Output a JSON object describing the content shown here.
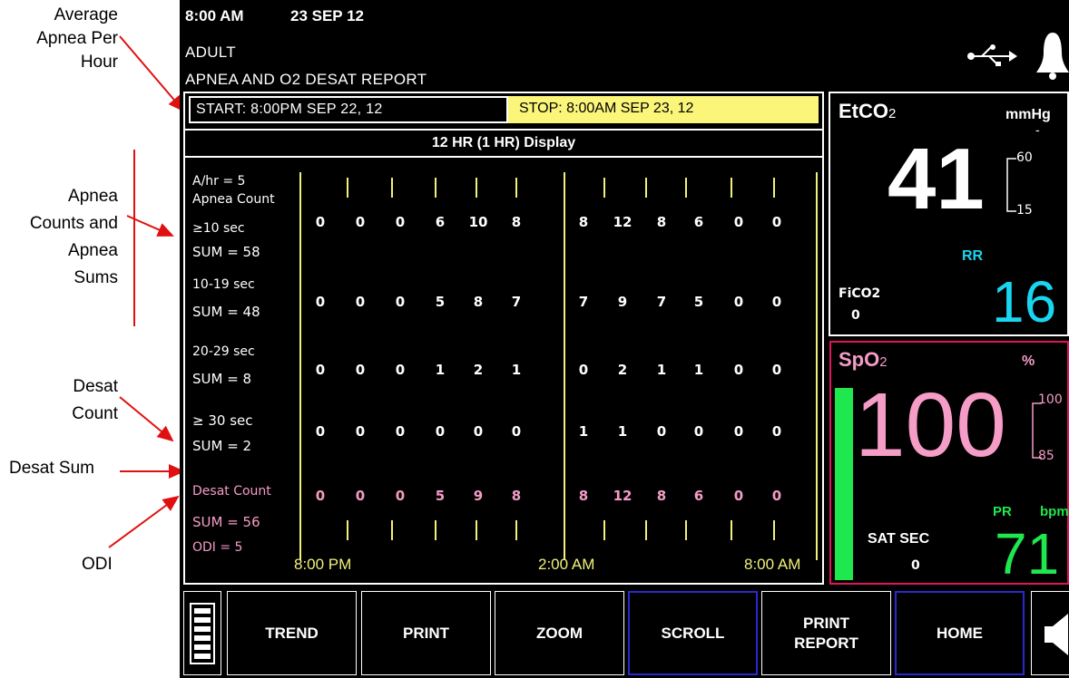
{
  "annotations": {
    "avg_apnea": "Average Apnea Per Hour",
    "avg_apnea_lines": [
      "Average",
      "Apnea Per",
      "Hour"
    ],
    "apnea_counts_lines": [
      "Apnea",
      "Counts and",
      "Apnea",
      "Sums"
    ],
    "desat_count_lines": [
      "Desat",
      "Count"
    ],
    "desat_sum": "Desat Sum",
    "odi": "ODI"
  },
  "status": {
    "time": "8:00 AM",
    "date": "23 SEP 12"
  },
  "patient_type": "ADULT",
  "report_title": "APNEA AND O2 DESAT REPORT",
  "report": {
    "start": "START: 8:00PM SEP 22, 12",
    "stop": "STOP: 8:00AM SEP 23, 12",
    "display_mode": "12 HR (1 HR) Display",
    "ahr": "A/hr = 5",
    "rows": [
      {
        "label1": "Apnea Count",
        "label2": "≥10 sec",
        "sum": "SUM = 58",
        "values": [
          "0",
          "0",
          "0",
          "6",
          "10",
          "8",
          "8",
          "12",
          "8",
          "6",
          "0",
          "0"
        ]
      },
      {
        "label1": "10-19 sec",
        "label2": "",
        "sum": "SUM = 48",
        "values": [
          "0",
          "0",
          "0",
          "5",
          "8",
          "7",
          "7",
          "9",
          "7",
          "5",
          "0",
          "0"
        ]
      },
      {
        "label1": "20-29 sec",
        "label2": "",
        "sum": "SUM = 8",
        "values": [
          "0",
          "0",
          "0",
          "1",
          "2",
          "1",
          "0",
          "2",
          "1",
          "1",
          "0",
          "0"
        ]
      },
      {
        "label1": "≥ 30 sec",
        "label2": "",
        "sum": "SUM = 2",
        "values": [
          "0",
          "0",
          "0",
          "0",
          "0",
          "0",
          "1",
          "1",
          "0",
          "0",
          "0",
          "0"
        ]
      }
    ],
    "desat": {
      "label": "Desat Count",
      "sum": "SUM = 56",
      "odi": "ODI =  5",
      "values": [
        "0",
        "0",
        "0",
        "5",
        "9",
        "8",
        "8",
        "12",
        "8",
        "6",
        "0",
        "0"
      ]
    },
    "time_axis": {
      "start": "8:00 PM",
      "mid": "2:00 AM",
      "end": "8:00 AM"
    }
  },
  "etco2": {
    "label": "EtCO",
    "sub": "2",
    "unit": "mmHg",
    "dash": "-",
    "value": "41",
    "high": "60",
    "low": "15",
    "rr_label": "RR",
    "rr_value": "16",
    "fico2_label": "FiCO2",
    "fico2_value": "0"
  },
  "spo2": {
    "label": "SpO",
    "sub": "2",
    "unit": "%",
    "value": "100",
    "high": "100",
    "low": "85",
    "pr_label": "PR",
    "pr_unit": "bpm",
    "pr_value": "71",
    "sat_sec_label": "SAT SEC",
    "sat_sec_value": "0"
  },
  "buttons": {
    "trend": "TREND",
    "print": "PRINT",
    "zoom": "ZOOM",
    "scroll": "SCROLL",
    "print_report_1": "PRINT",
    "print_report_2": "REPORT",
    "home": "HOME"
  },
  "colors": {
    "yellow": "#f2f07a",
    "pink": "#f59cc7",
    "cyan": "#19d6f0",
    "green": "#1fe84e",
    "spo2_border": "#e0145a"
  }
}
